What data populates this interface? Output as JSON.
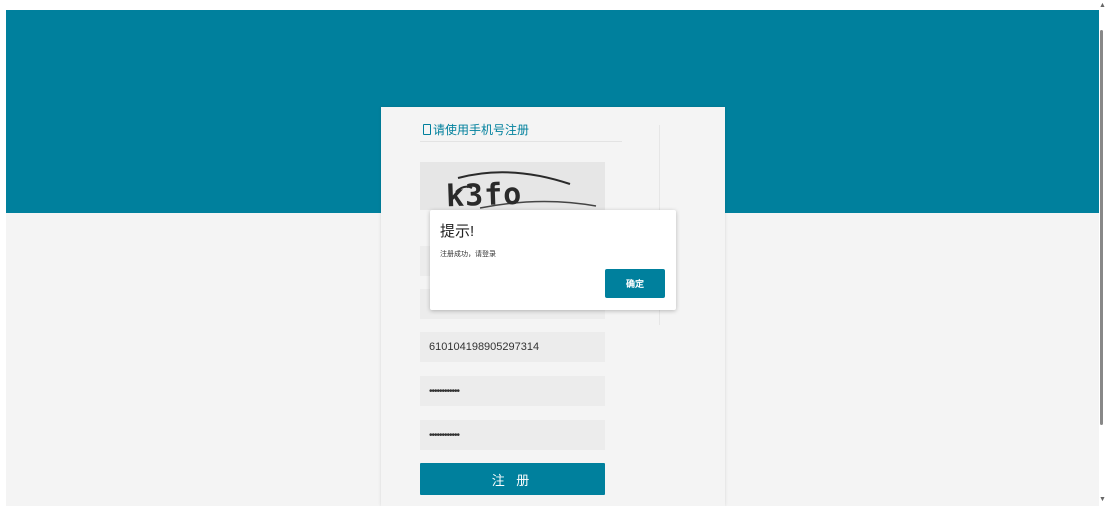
{
  "colors": {
    "accent": "#00809d",
    "page_background": "#f4f4f4",
    "input_background": "#ececec"
  },
  "register_form": {
    "heading": "请使用手机号注册",
    "heading_icon": "mobile-phone-icon",
    "captcha_text": "k3fo",
    "id_number_value": "610104198905297314",
    "password_value": "••••••••••••",
    "confirm_password_value": "••••••••••••",
    "submit_label": "注 册"
  },
  "dialog": {
    "title": "提示!",
    "message": "注册成功，请登录",
    "confirm_label": "确定"
  }
}
